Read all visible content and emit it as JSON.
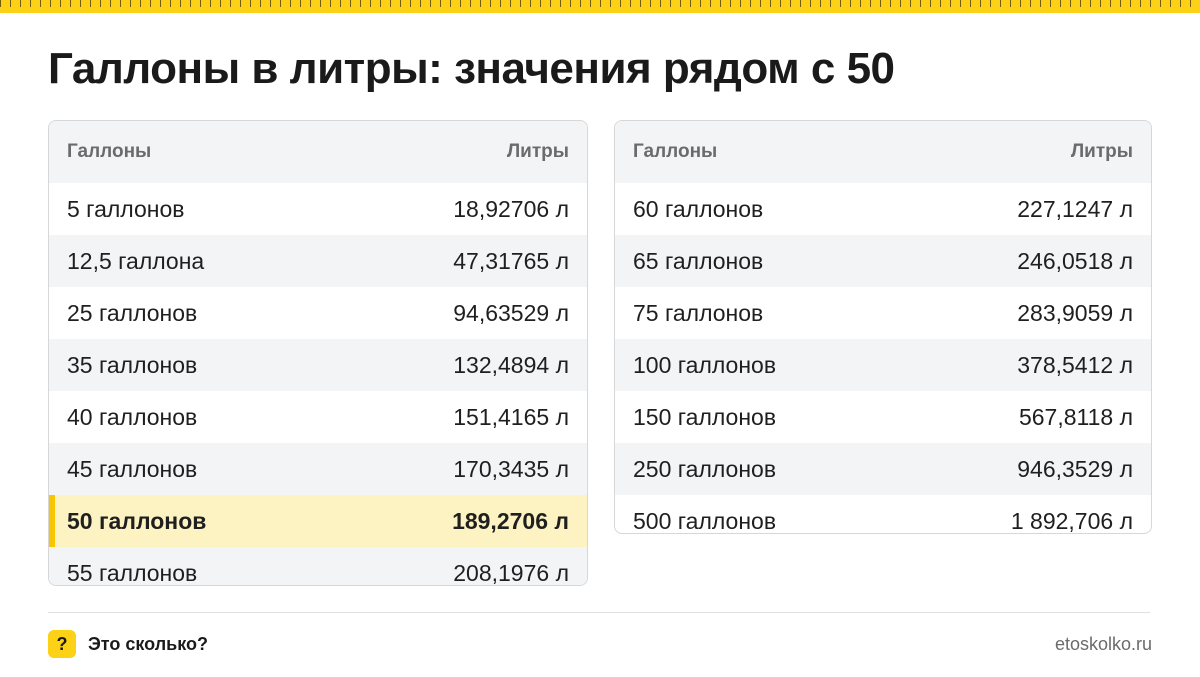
{
  "title": "Галлоны в литры: значения рядом с 50",
  "colors": {
    "accent": "#fcd116",
    "highlight_row": "#fdf2c2",
    "alt_row": "#f3f4f6"
  },
  "left_table": {
    "headers": [
      "Галлоны",
      "Литры"
    ],
    "rows": [
      [
        "5 галлонов",
        "18,92706 л"
      ],
      [
        "12,5 галлона",
        "47,31765 л"
      ],
      [
        "25 галлонов",
        "94,63529 л"
      ],
      [
        "35 галлонов",
        "132,4894 л"
      ],
      [
        "40 галлонов",
        "151,4165 л"
      ],
      [
        "45 галлонов",
        "170,3435 л"
      ],
      [
        "50 галлонов",
        "189,2706 л"
      ],
      [
        "55 галлонов",
        "208,1976 л"
      ]
    ],
    "highlighted_row": 6
  },
  "right_table": {
    "headers": [
      "Галлоны",
      "Литры"
    ],
    "rows": [
      [
        "60 галлонов",
        "227,1247 л"
      ],
      [
        "65 галлонов",
        "246,0518 л"
      ],
      [
        "75 галлонов",
        "283,9059 л"
      ],
      [
        "100 галлонов",
        "378,5412 л"
      ],
      [
        "150 галлонов",
        "567,8118 л"
      ],
      [
        "250 галлонов",
        "946,3529 л"
      ],
      [
        "500 галлонов",
        "1 892,706 л"
      ]
    ]
  },
  "footer": {
    "icon": "question-mark-icon",
    "icon_glyph": "?",
    "brand": "Это сколько?",
    "site": "etoskolko.ru"
  }
}
